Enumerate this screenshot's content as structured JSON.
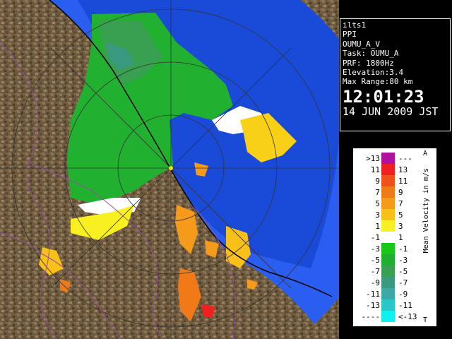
{
  "info": {
    "station": "ilts1",
    "scan_type": "PPI",
    "product": "OUMU_A_V",
    "task": "Task: OUMU_A",
    "prf": "PRF: 1800Hz",
    "elevation": "Elevation:3.4",
    "max_range": "Max Range:80 km",
    "time": "12:01:23",
    "date": "14 JUN 2009 JST"
  },
  "legend": {
    "title": "Mean Velocity in m/s",
    "corner_top": "A",
    "corner_bottom": "T",
    "bins": [
      {
        "left": ">13",
        "right": "---",
        "color": "#b0109e"
      },
      {
        "left": "11",
        "right": "13",
        "color": "#f02020"
      },
      {
        "left": "9",
        "right": "11",
        "color": "#f0501c"
      },
      {
        "left": "7",
        "right": "9",
        "color": "#f07a18"
      },
      {
        "left": "5",
        "right": "7",
        "color": "#f59a1a"
      },
      {
        "left": "3",
        "right": "5",
        "color": "#f8c018"
      },
      {
        "left": "1",
        "right": "3",
        "color": "#f8f020"
      },
      {
        "left": "-1",
        "right": "1",
        "color": "#ffffff"
      },
      {
        "left": "-3",
        "right": "-1",
        "color": "#18c818"
      },
      {
        "left": "-5",
        "right": "-3",
        "color": "#20b030"
      },
      {
        "left": "-7",
        "right": "-5",
        "color": "#38a050"
      },
      {
        "left": "-9",
        "right": "-7",
        "color": "#3a9a80"
      },
      {
        "left": "-11",
        "right": "-9",
        "color": "#3ca8a8"
      },
      {
        "left": "-13",
        "right": "-11",
        "color": "#28c8c8"
      },
      {
        "left": "----",
        "right": "<-13",
        "color": "#10f0f0"
      }
    ]
  },
  "map": {
    "range_circle_color": "#1a4ad8",
    "coverage_ring_color": "#2a5ef0",
    "land_color": "#6e5a3e",
    "radar_site_color": "#f0e010"
  }
}
